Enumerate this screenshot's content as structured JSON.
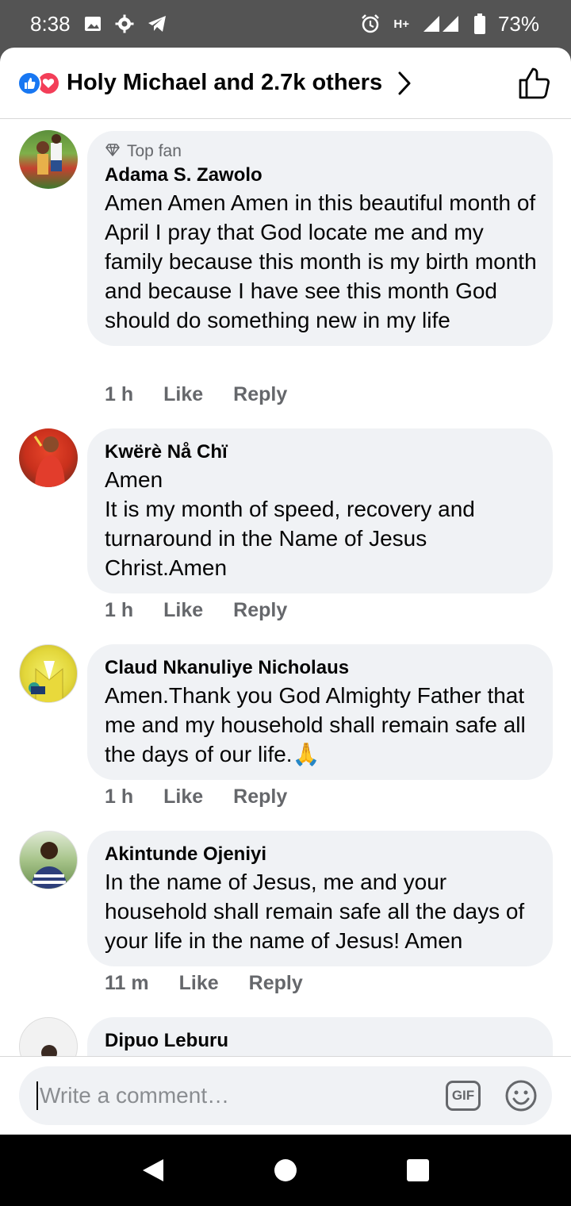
{
  "status_bar": {
    "time": "8:38",
    "battery": "73%",
    "network": "H+",
    "left_icons": [
      "gallery-icon",
      "settings-icon",
      "telegram-icon"
    ],
    "right_icons": [
      "alarm-icon",
      "network-icon",
      "signal-icon",
      "battery-icon"
    ]
  },
  "header": {
    "reaction_icons": [
      "like-reaction-icon",
      "love-reaction-icon"
    ],
    "reactions_text": "Holy Michael and 2.7k others",
    "like_button_icon": "thumbs-up-icon"
  },
  "comments": [
    {
      "author": "Adama S. Zawolo",
      "badge": "Top fan",
      "text": "Amen Amen Amen in this beautiful month of April I pray that God locate me and my family because this month is my birth month and because I have see this month God should do something new in my life",
      "time": "1 h",
      "like": "Like",
      "reply": "Reply"
    },
    {
      "author": "Kwërè Nå Chï",
      "badge": "",
      "text": "Amen\nIt is my month of speed, recovery and turnaround in the Name of Jesus Christ.Amen",
      "time": "1 h",
      "like": "Like",
      "reply": "Reply"
    },
    {
      "author": "Claud Nkanuliye Nicholaus",
      "badge": "",
      "text": "Amen.Thank you God Almighty Father that me and my household shall remain safe all the days of our life.🙏",
      "time": "1 h",
      "like": "Like",
      "reply": "Reply"
    },
    {
      "author": "Akintunde Ojeniyi",
      "badge": "",
      "text": "In the name of Jesus,  me and your household shall remain safe all the days of your life in the name of Jesus! Amen",
      "time": "11 m",
      "like": "Like",
      "reply": "Reply"
    },
    {
      "author": "Dipuo Leburu",
      "badge": "",
      "text": "",
      "time": "",
      "like": "",
      "reply": ""
    }
  ],
  "composer": {
    "placeholder": "Write a comment…",
    "gif_label": "GIF",
    "emoji_icon": "emoji-icon"
  },
  "nav_bar": {
    "buttons": [
      "back-icon",
      "home-icon",
      "recents-icon"
    ]
  }
}
